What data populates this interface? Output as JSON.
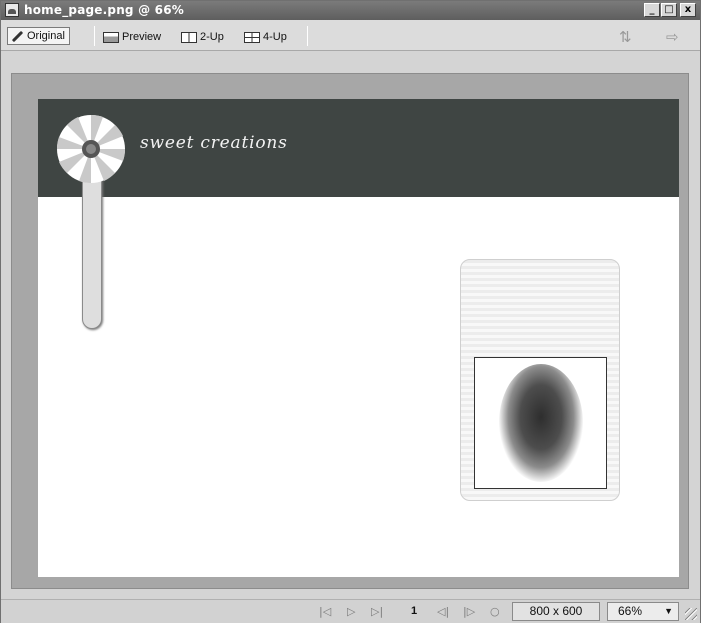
{
  "window": {
    "title": "home_page.png @ 66%",
    "controls": {
      "minimize": "_",
      "maximize": "□",
      "close": "x"
    }
  },
  "toolbar": {
    "tabs": [
      {
        "label": "Original",
        "icon": "pencil-icon",
        "active": true
      },
      {
        "label": "Preview",
        "icon": "preview-icon",
        "active": false
      },
      {
        "label": "2-Up",
        "icon": "two-up-icon",
        "active": false
      },
      {
        "label": "4-Up",
        "icon": "four-up-icon",
        "active": false
      }
    ],
    "right_icons": [
      "export-icon",
      "quick-export-icon"
    ]
  },
  "canvas": {
    "banner_text": "sweet creations",
    "colors": {
      "banner": "#3f4543",
      "page": "#ffffff",
      "card": "#ececec"
    }
  },
  "statusbar": {
    "frame_number": "1",
    "dimensions": "800 x 600",
    "zoom": "66%",
    "nav_icons": [
      "first-frame-icon",
      "play-icon",
      "last-frame-icon",
      "prev-frame-icon",
      "next-frame-icon",
      "loop-icon"
    ]
  }
}
